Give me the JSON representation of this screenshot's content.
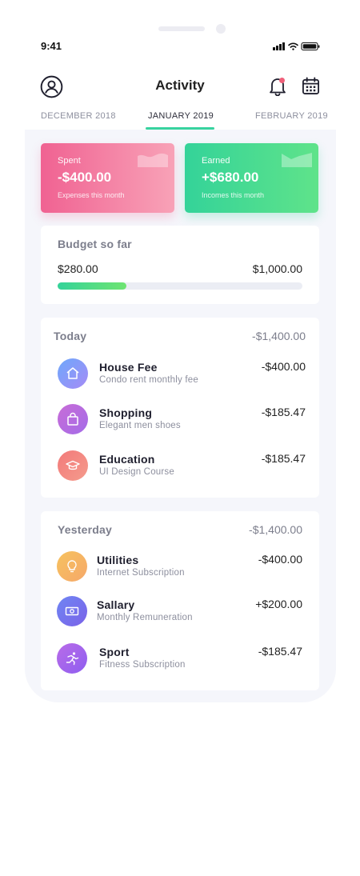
{
  "status_bar": {
    "time": "9:41"
  },
  "header": {
    "title": "Activity"
  },
  "months": {
    "prev": "DECEMBER 2018",
    "current": "JANUARY 2019",
    "next": "FEBRUARY 2019"
  },
  "summary": {
    "spent": {
      "label": "Spent",
      "amount": "-$400.00",
      "sub": "Expenses this month",
      "color": "#f06292"
    },
    "earned": {
      "label": "Earned",
      "amount": "+$680.00",
      "sub": "Incomes this month",
      "color": "#34d399"
    }
  },
  "budget": {
    "title": "Budget so far",
    "current": "$280.00",
    "total": "$1,000.00",
    "progress_fraction": 0.28
  },
  "today": {
    "title": "Today",
    "total": "-$1,400.00",
    "items": [
      {
        "name": "House Fee",
        "sub": "Condo rent monthly fee",
        "amount": "-$400.00",
        "icon": "house-icon"
      },
      {
        "name": "Shopping",
        "sub": "Elegant men shoes",
        "amount": "-$185.47",
        "icon": "shopping-bag-icon"
      },
      {
        "name": "Education",
        "sub": "UI Design Course",
        "amount": "-$185.47",
        "icon": "graduation-cap-icon"
      }
    ]
  },
  "yesterday": {
    "title": "Yesterday",
    "total": "-$1,400.00",
    "items": [
      {
        "name": "Utilities",
        "sub": "Internet Subscription",
        "amount": "-$400.00",
        "icon": "lightbulb-icon"
      },
      {
        "name": "Sallary",
        "sub": "Monthly Remuneration",
        "amount": "+$200.00",
        "icon": "money-icon"
      },
      {
        "name": "Sport",
        "sub": "Fitness Subscription",
        "amount": "-$185.47",
        "icon": "runner-icon"
      }
    ]
  },
  "colors": {
    "accent": "#38d39f",
    "notification_dot": "#f0607a"
  }
}
